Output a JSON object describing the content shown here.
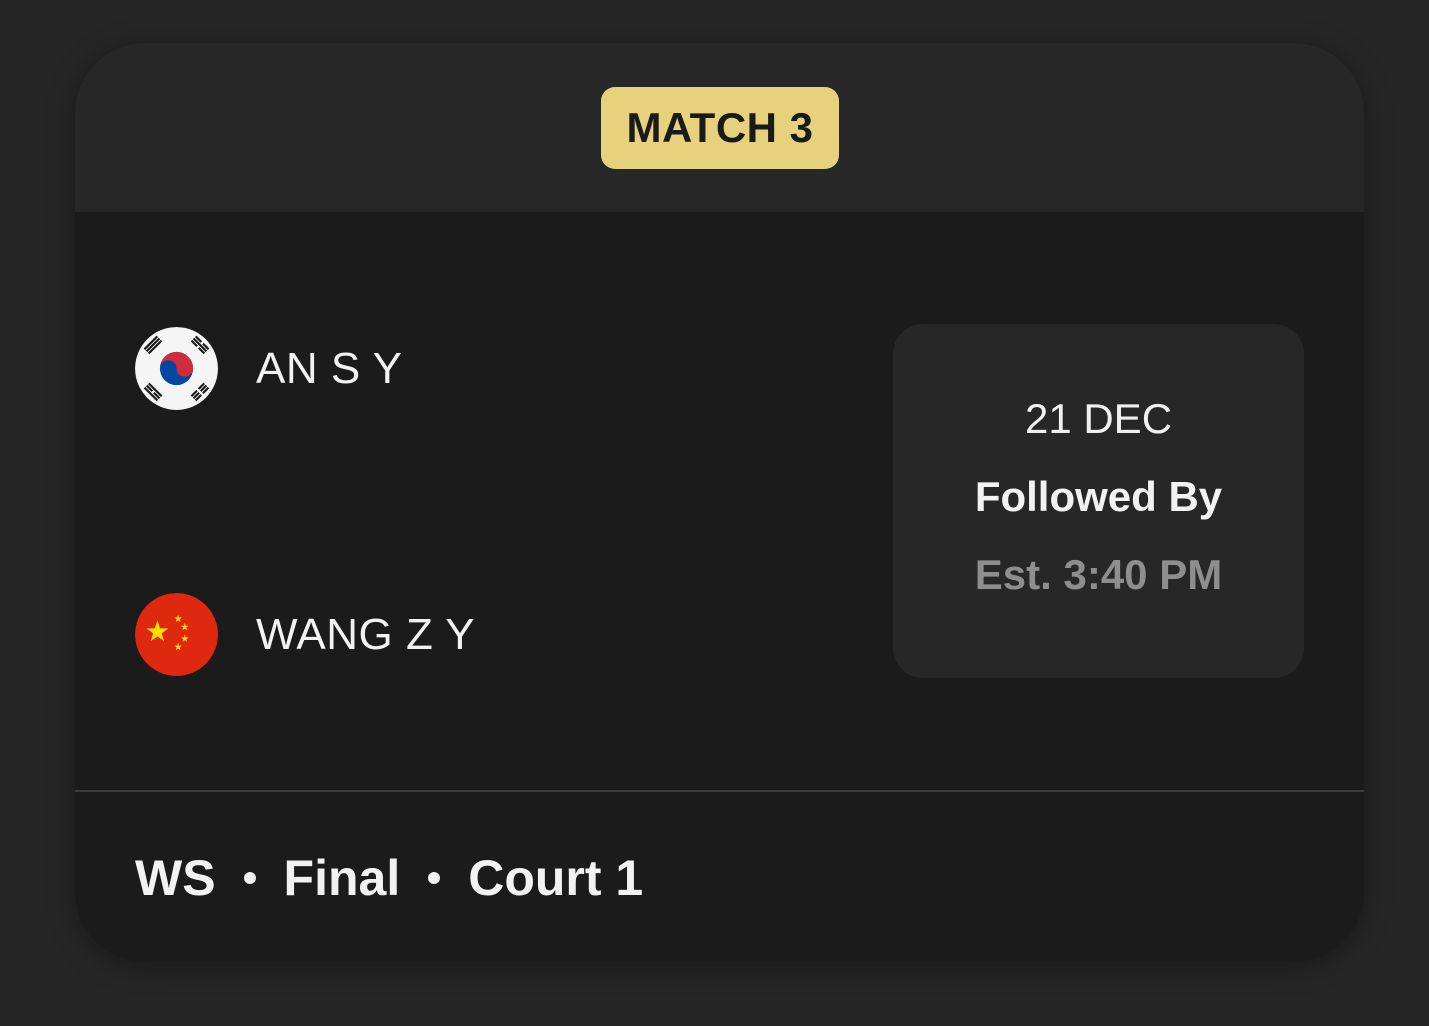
{
  "match": {
    "badge": "MATCH 3",
    "badge_color": "#e6d27c"
  },
  "players": [
    {
      "name": "AN S Y",
      "flag_icon": "south-korea-flag-icon"
    },
    {
      "name": "WANG Z Y",
      "flag_icon": "china-flag-icon"
    }
  ],
  "schedule": {
    "date": "21 DEC",
    "followed_by": "Followed By",
    "estimate": "Est. 3:40 PM"
  },
  "footer": {
    "event": "WS",
    "round": "Final",
    "court": "Court 1"
  }
}
